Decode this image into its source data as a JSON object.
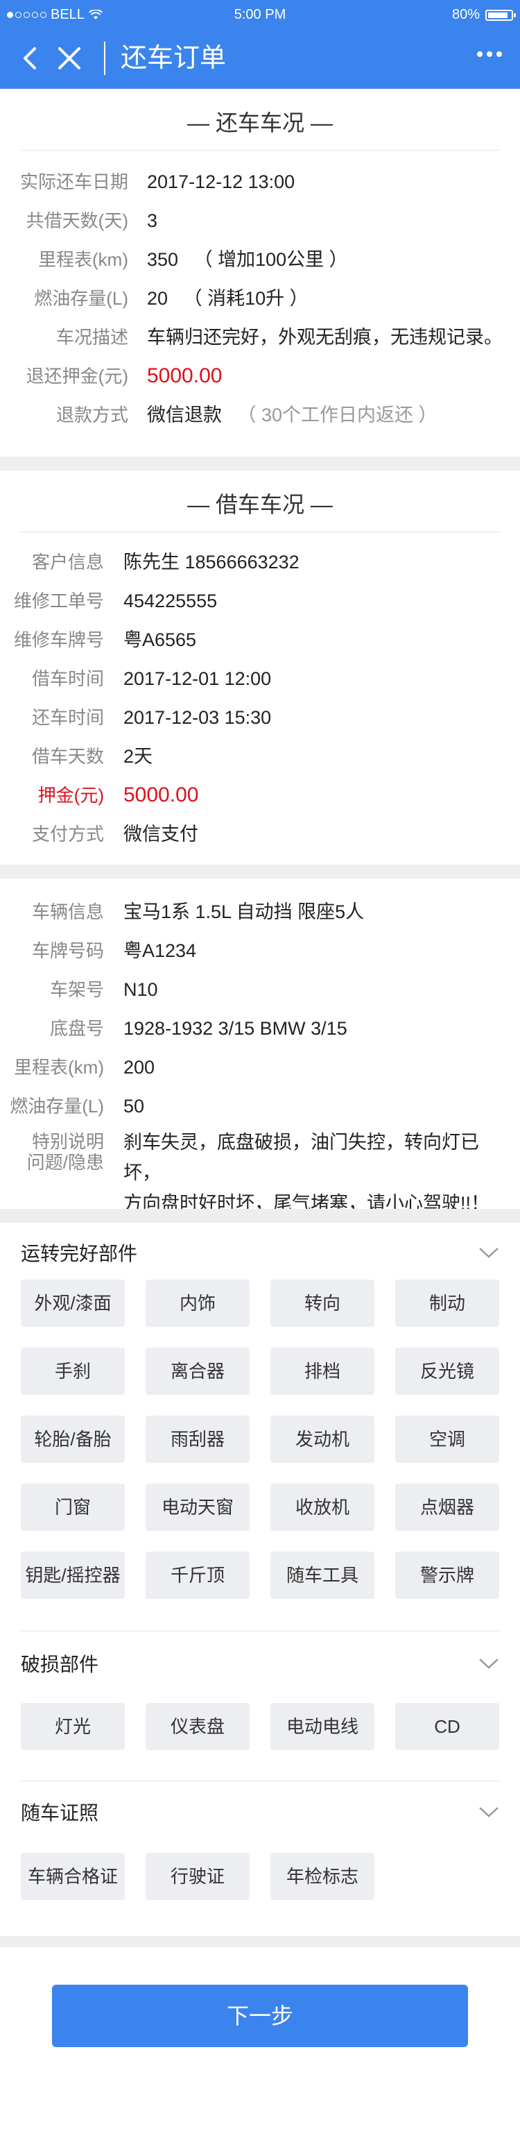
{
  "status_bar": {
    "carrier": "BELL",
    "time": "5:00 PM",
    "battery": "80%"
  },
  "nav": {
    "title": "还车订单"
  },
  "return_section": {
    "title": "— 还车车况 —",
    "rows": [
      {
        "label": "实际还车日期",
        "value": "2017-12-12  13:00"
      },
      {
        "label": "共借天数(天)",
        "value": "3"
      },
      {
        "label": "里程表(km)",
        "value": "350",
        "note": "（ 增加100公里 ）"
      },
      {
        "label": "燃油存量(L)",
        "value": "20",
        "note": "（ 消耗10升 ）"
      },
      {
        "label": "车况描述",
        "value": "车辆归还完好，外观无刮痕，无违规记录。"
      },
      {
        "label": "退还押金(元)",
        "value": "5000.00"
      },
      {
        "label": "退款方式",
        "value": "微信退款",
        "note": "（ 30个工作日内返还 ）"
      }
    ]
  },
  "borrow_section": {
    "title": "— 借车车况 —",
    "rows": [
      {
        "label": "客户信息",
        "value": "陈先生  18566663232"
      },
      {
        "label": "维修工单号",
        "value": "454225555"
      },
      {
        "label": "维修车牌号",
        "value": "粤A6565"
      },
      {
        "label": "借车时间",
        "value": "2017-12-01 12:00"
      },
      {
        "label": "还车时间",
        "value": "2017-12-03 15:30"
      },
      {
        "label": "借车天数",
        "value": "2天"
      },
      {
        "label": "押金(元)",
        "value": "5000.00"
      },
      {
        "label": "支付方式",
        "value": "微信支付"
      }
    ]
  },
  "vehicle_section": {
    "rows": [
      {
        "label": "车辆信息",
        "value": "宝马1系  1.5L  自动挡  限座5人"
      },
      {
        "label": "车牌号码",
        "value": "粤A1234"
      },
      {
        "label": "车架号",
        "value": "N10"
      },
      {
        "label": "底盘号",
        "value": "1928-1932 3/15 BMW 3/15"
      },
      {
        "label": "里程表(km)",
        "value": "200"
      },
      {
        "label": "燃油存量(L)",
        "value": "50"
      }
    ],
    "special": {
      "label_line1": "特别说明",
      "label_line2": "问题/隐患",
      "line1": "刹车失灵，底盘破损，油门失控，转向灯已坏，",
      "line2": "方向盘时好时坏，尾气堵塞，请小心驾驶!!！"
    }
  },
  "good_parts": {
    "title": "运转完好部件",
    "items": [
      "外观/漆面",
      "内饰",
      "转向",
      "制动",
      "手刹",
      "离合器",
      "排档",
      "反光镜",
      "轮胎/备胎",
      "雨刮器",
      "发动机",
      "空调",
      "门窗",
      "电动天窗",
      "收放机",
      "点烟器",
      "钥匙/摇控器",
      "千斤顶",
      "随车工具",
      "警示牌"
    ]
  },
  "damaged_parts": {
    "title": "破损部件",
    "items": [
      "灯光",
      "仪表盘",
      "电动电线",
      "CD"
    ]
  },
  "documents": {
    "title": "随车证照",
    "items": [
      "车辆合格证",
      "行驶证",
      "年检标志"
    ]
  },
  "footer": {
    "next_label": "下一步"
  },
  "colors": {
    "primary": "#3b84ee",
    "danger": "#e0101a",
    "chip_bg": "#eceef1",
    "gap_bg": "#eeeeee"
  }
}
